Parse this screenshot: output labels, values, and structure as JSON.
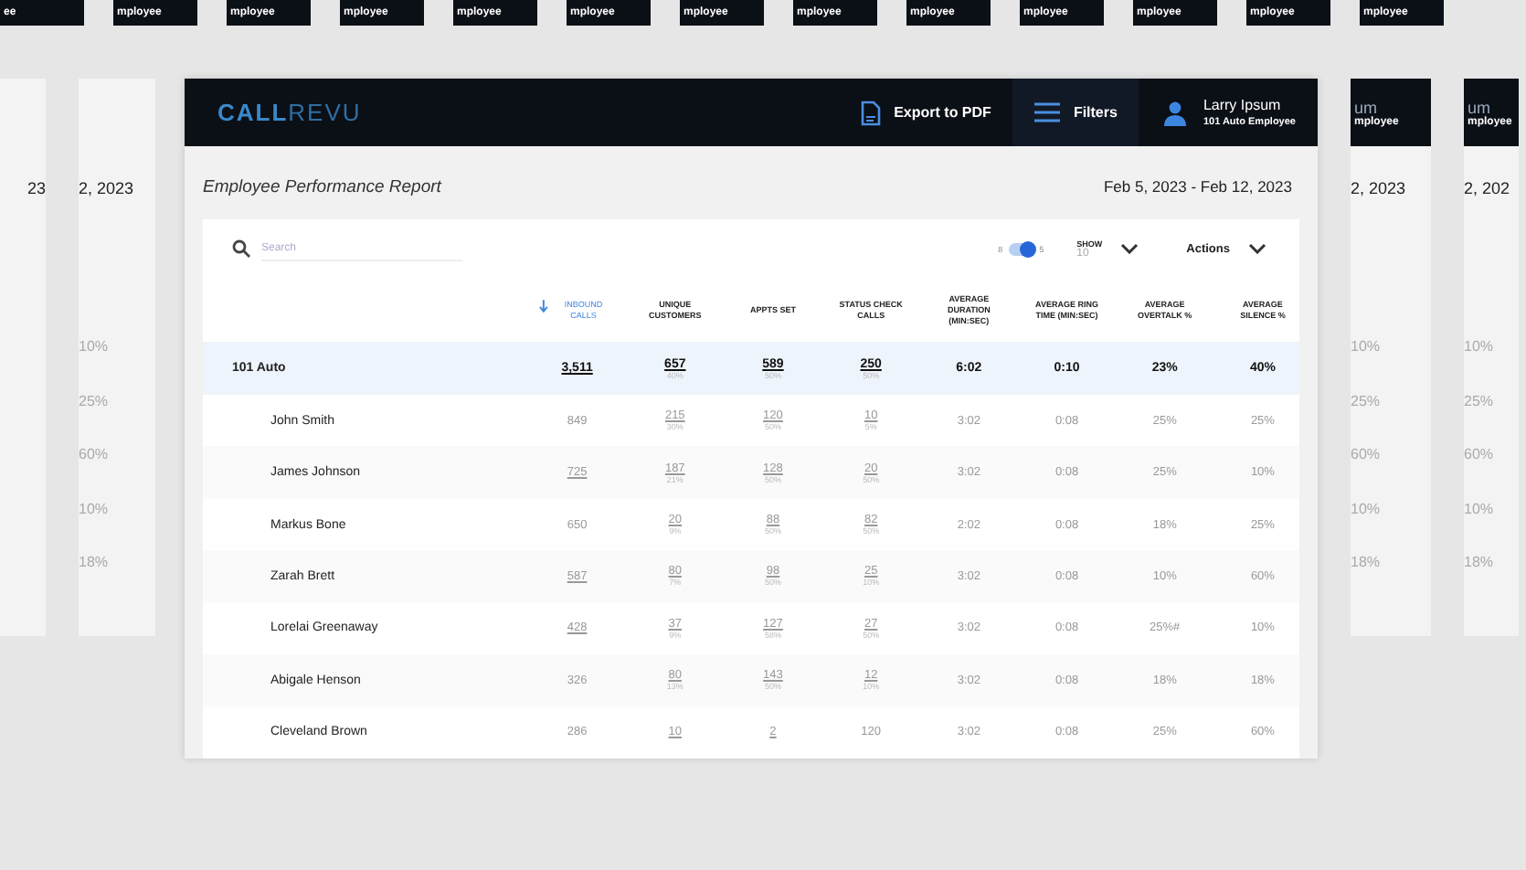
{
  "backdrop": {
    "top_tiles": [
      "ee",
      "mployee",
      "mployee",
      "mployee",
      "mployee",
      "mployee",
      "mployee",
      "mployee",
      "mployee",
      "mployee",
      "mployee",
      "mployee",
      "mployee"
    ],
    "left_panels": [
      {
        "date": "23"
      },
      {
        "date": "2, 2023",
        "values": [
          "10%",
          "25%",
          "60%",
          "10%",
          "18%"
        ]
      }
    ],
    "right_panels": [
      {
        "header": [
          "um",
          "mployee"
        ],
        "date": "2, 2023",
        "values": [
          "10%",
          "25%",
          "60%",
          "10%",
          "18%"
        ]
      },
      {
        "header": [
          "um",
          "mployee"
        ],
        "date": "2, 202",
        "values": [
          "10%",
          "25%",
          "60%",
          "10%",
          "18%"
        ]
      }
    ]
  },
  "app": {
    "logo": {
      "bold": "CALL",
      "light": "REVU"
    },
    "nav": [
      {
        "kind": "pdf",
        "label": "Export to PDF"
      },
      {
        "kind": "filter",
        "label": "Filters"
      }
    ],
    "user": {
      "name": "Larry Ipsum",
      "role": "101 Auto Employee"
    }
  },
  "report": {
    "title": "Employee Performance Report",
    "date_range": "Feb 5, 2023 - Feb 12, 2023"
  },
  "toolbar": {
    "search": {
      "placeholder": "Search"
    },
    "toggle": {
      "left_label": "8",
      "right_label": "5",
      "on": true
    },
    "show": {
      "label": "SHOW",
      "value": "10"
    },
    "actions": "Actions"
  },
  "table": {
    "columns": [
      {
        "label": "INBOUND CALLS",
        "sorted": true
      },
      {
        "label": "UNIQUE CUSTOMERS",
        "sorted": false
      },
      {
        "label": "APPTS SET",
        "sorted": false
      },
      {
        "label": "STATUS CHECK CALLS",
        "sorted": false
      },
      {
        "label": "AVERAGE DURATION (MIN:SEC)",
        "sorted": false
      },
      {
        "label": "AVERAGE RING TIME (MIN:SEC)",
        "sorted": false
      },
      {
        "label": "AVERAGE OVERTALK %",
        "sorted": false
      },
      {
        "label": "AVERAGE SILENCE %",
        "sorted": false
      }
    ],
    "rows": [
      {
        "kind": "group",
        "name": "101 Auto",
        "cells": [
          {
            "value": "3,511",
            "link": true
          },
          {
            "value": "657",
            "sub": "40%",
            "link": true
          },
          {
            "value": "589",
            "sub": "50%",
            "link": true
          },
          {
            "value": "250",
            "sub": "50%",
            "link": true
          },
          {
            "value": "6:02"
          },
          {
            "value": "0:10"
          },
          {
            "value": "23%"
          },
          {
            "value": "40%"
          }
        ]
      },
      {
        "kind": "member",
        "name": "John Smith",
        "cells": [
          {
            "value": "849",
            "link": false
          },
          {
            "value": "215",
            "sub": "30%",
            "link": true
          },
          {
            "value": "120",
            "sub": "50%",
            "link": true
          },
          {
            "value": "10",
            "sub": "5%",
            "link": true
          },
          {
            "value": "3:02"
          },
          {
            "value": "0:08"
          },
          {
            "value": "25%"
          },
          {
            "value": "25%"
          }
        ]
      },
      {
        "kind": "member",
        "name": "James Johnson",
        "cells": [
          {
            "value": "725",
            "link": true
          },
          {
            "value": "187",
            "sub": "21%",
            "link": true
          },
          {
            "value": "128",
            "sub": "50%",
            "link": true
          },
          {
            "value": "20",
            "sub": "50%",
            "link": true
          },
          {
            "value": "3:02"
          },
          {
            "value": "0:08"
          },
          {
            "value": "25%"
          },
          {
            "value": "10%"
          }
        ]
      },
      {
        "kind": "member",
        "name": "Markus Bone",
        "cells": [
          {
            "value": "650",
            "link": false
          },
          {
            "value": "20",
            "sub": "9%",
            "link": true
          },
          {
            "value": "88",
            "sub": "50%",
            "link": true
          },
          {
            "value": "82",
            "sub": "50%",
            "link": true
          },
          {
            "value": "2:02"
          },
          {
            "value": "0:08"
          },
          {
            "value": "18%"
          },
          {
            "value": "25%"
          }
        ]
      },
      {
        "kind": "member",
        "name": "Zarah Brett",
        "cells": [
          {
            "value": "587",
            "link": true
          },
          {
            "value": "80",
            "sub": "7%",
            "link": true
          },
          {
            "value": "98",
            "sub": "50%",
            "link": true
          },
          {
            "value": "25",
            "sub": "10%",
            "link": true
          },
          {
            "value": "3:02"
          },
          {
            "value": "0:08"
          },
          {
            "value": "10%"
          },
          {
            "value": "60%"
          }
        ]
      },
      {
        "kind": "member",
        "name": "Lorelai Greenaway",
        "cells": [
          {
            "value": "428",
            "link": true
          },
          {
            "value": "37",
            "sub": "9%",
            "link": true
          },
          {
            "value": "127",
            "sub": "58%",
            "link": true
          },
          {
            "value": "27",
            "sub": "50%",
            "link": true
          },
          {
            "value": "3:02"
          },
          {
            "value": "0:08"
          },
          {
            "value": "25%#"
          },
          {
            "value": "10%"
          }
        ]
      },
      {
        "kind": "member",
        "name": "Abigale Henson",
        "cells": [
          {
            "value": "326",
            "link": false
          },
          {
            "value": "80",
            "sub": "13%",
            "link": true
          },
          {
            "value": "143",
            "sub": "50%",
            "link": true
          },
          {
            "value": "12",
            "sub": "10%",
            "link": true
          },
          {
            "value": "3:02"
          },
          {
            "value": "0:08"
          },
          {
            "value": "18%"
          },
          {
            "value": "18%"
          }
        ]
      },
      {
        "kind": "member",
        "name": "Cleveland Brown",
        "cells": [
          {
            "value": "286",
            "link": false
          },
          {
            "value": "10",
            "link": true
          },
          {
            "value": "2",
            "link": true
          },
          {
            "value": "120",
            "link": false
          },
          {
            "value": "3:02"
          },
          {
            "value": "0:08"
          },
          {
            "value": "25%"
          },
          {
            "value": "60%"
          }
        ]
      }
    ]
  }
}
